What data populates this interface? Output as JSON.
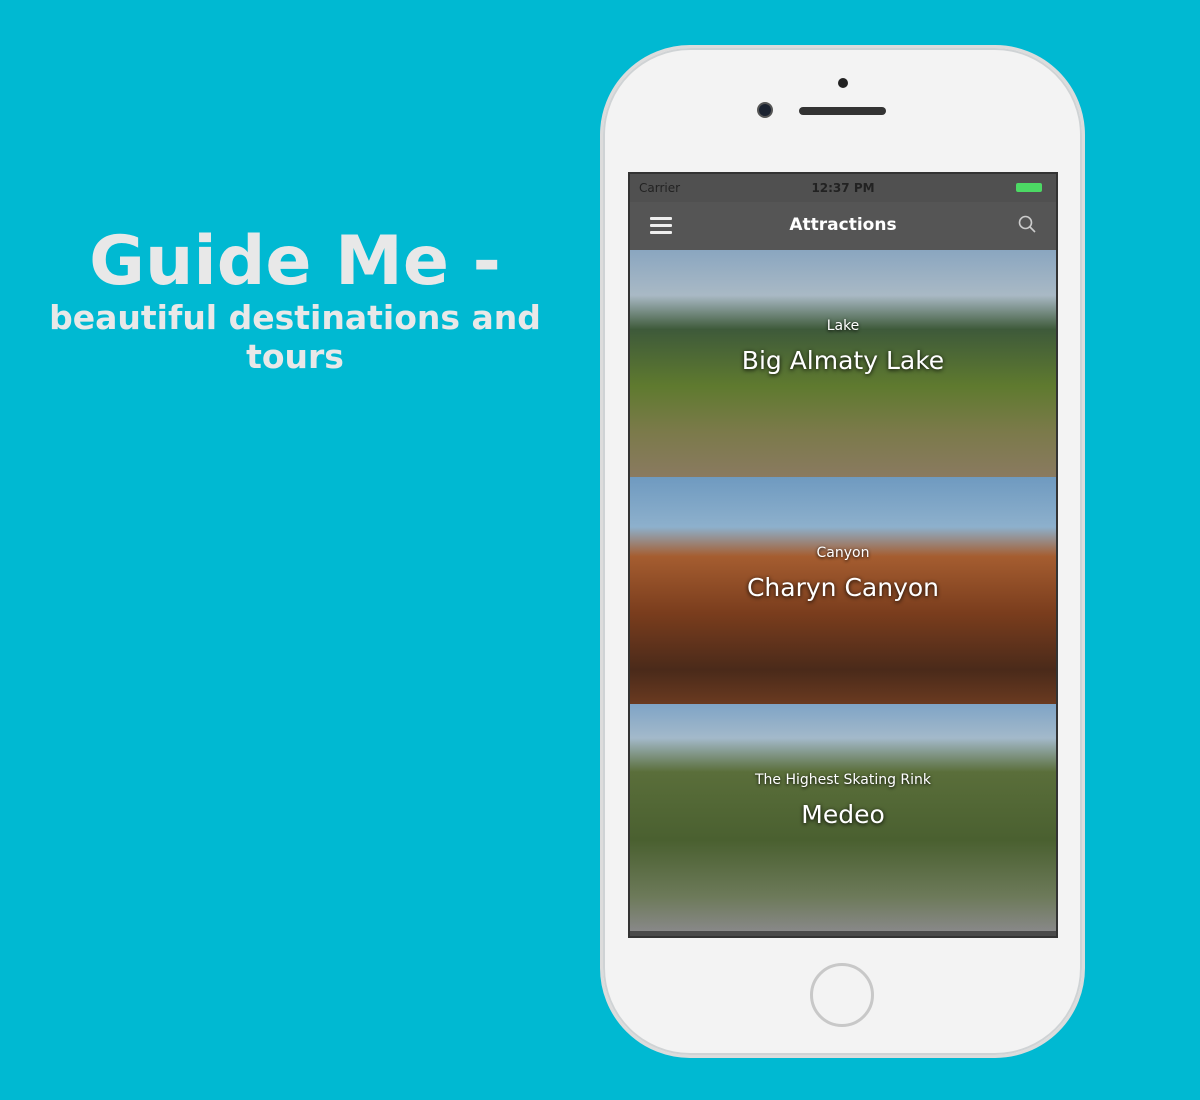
{
  "promo": {
    "title": "Guide Me -",
    "subtitle": "beautiful destinations and tours"
  },
  "status_bar": {
    "carrier": "Carrier",
    "time": "12:37 PM"
  },
  "nav": {
    "title": "Attractions"
  },
  "attractions": [
    {
      "category": "Lake",
      "name": "Big Almaty Lake"
    },
    {
      "category": "Canyon",
      "name": "Charyn Canyon"
    },
    {
      "category": "The Highest Skating Rink",
      "name": "Medeo"
    }
  ],
  "colors": {
    "background": "#00b9d2",
    "navbar": "#555555"
  }
}
